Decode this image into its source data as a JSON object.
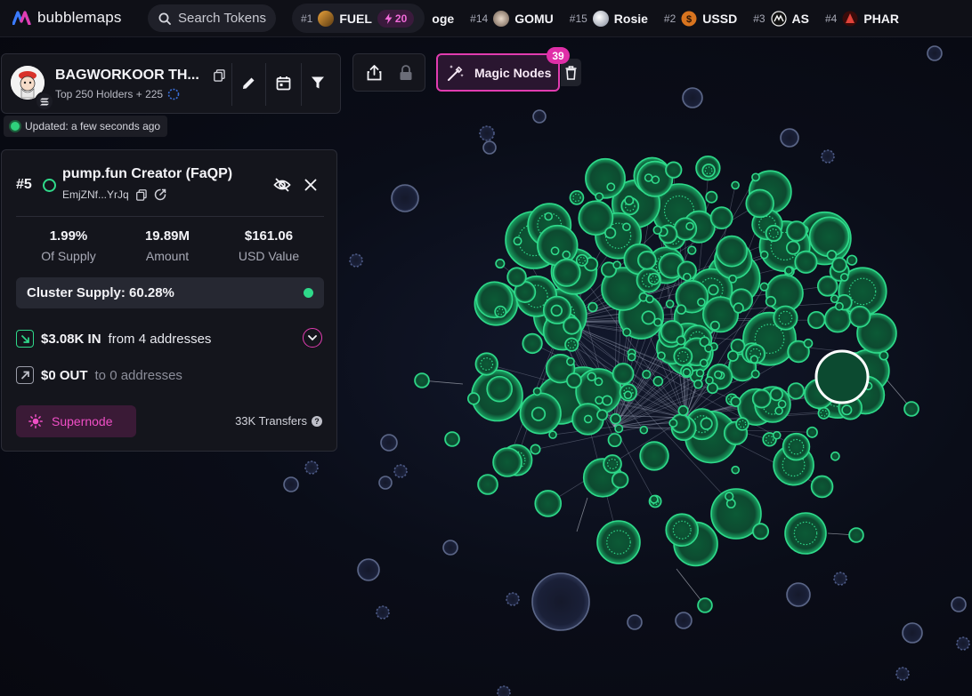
{
  "app": {
    "logo_text": "bubblemaps",
    "search_placeholder": "Search Tokens"
  },
  "ticker": [
    {
      "rank": "#1",
      "name": "FUEL",
      "boost": "20",
      "coin_color": "#5b3a12"
    },
    {
      "rank": "",
      "name": "oge",
      "coin_color": ""
    },
    {
      "rank": "#14",
      "name": "GOMU",
      "coin_color": "#b9a79a"
    },
    {
      "rank": "#15",
      "name": "Rosie",
      "coin_color": "#d9dde6"
    },
    {
      "rank": "#2",
      "name": "USSD",
      "coin_color": "#d8741f"
    },
    {
      "rank": "#3",
      "name": "AS",
      "coin_color": "#f0f0f0"
    },
    {
      "rank": "#4",
      "name": "PHAR",
      "coin_color": "#8a1612"
    }
  ],
  "token": {
    "name": "BAGWORKOOR TH...",
    "subtitle": "Top 250 Holders + 225",
    "updated": "Updated: a few seconds ago"
  },
  "magic_nodes": {
    "label": "Magic Nodes",
    "count": "39"
  },
  "details": {
    "rank": "#5",
    "name": "pump.fun Creator (FaQP)",
    "address": "EmjZNf...YrJq",
    "stats": [
      {
        "value": "1.99%",
        "label": "Of Supply"
      },
      {
        "value": "19.89M",
        "label": "Amount"
      },
      {
        "value": "$161.06",
        "label": "USD Value"
      }
    ],
    "cluster_supply": "Cluster Supply: 60.28%",
    "in_amount": "$3.08K IN",
    "in_text": "from 4 addresses",
    "out_amount": "$0 OUT",
    "out_text": "to 0 addresses",
    "supernode_label": "Supernode",
    "transfers": "33K Transfers"
  },
  "colors": {
    "accent_pink": "#e13cb0",
    "bubble_green": "#2fd98a",
    "bubble_gray": "#4a5577",
    "panel_bg": "#14151c"
  }
}
